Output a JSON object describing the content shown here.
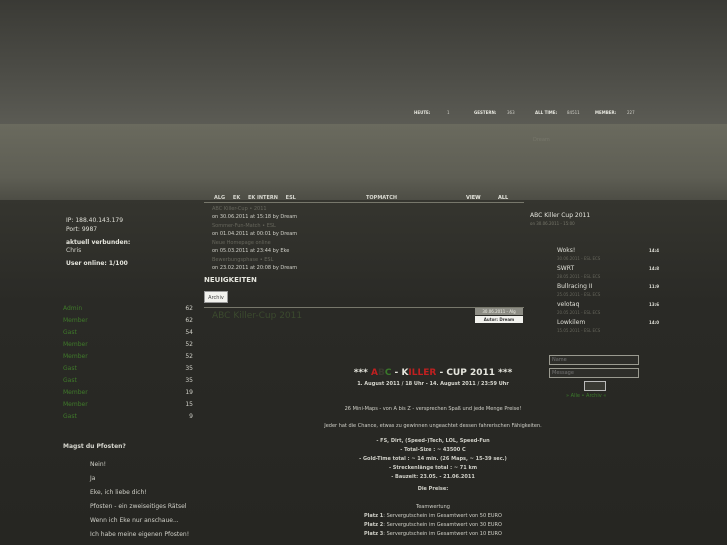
{
  "header": {
    "stats": [
      {
        "label": "HEUTE:",
        "value": "1"
      },
      {
        "label": "GESTERN:",
        "value": "363"
      },
      {
        "label": "ALL TIME:",
        "value": "84511"
      },
      {
        "label": "MEMBER:",
        "value": "227"
      }
    ],
    "faint_text": "Dream"
  },
  "server": {
    "ip": "IP: 188.40.143.179",
    "port": "Port: 9987",
    "connected_heading": "aktuell verbunden:",
    "connected_user": "Chris",
    "online": "User online: 1/100"
  },
  "clan_list": [
    {
      "label": "Admin",
      "count": "62"
    },
    {
      "label": "Member",
      "count": "62"
    },
    {
      "label": "Gast",
      "count": "54"
    },
    {
      "label": "Member",
      "count": "52"
    },
    {
      "label": "Member",
      "count": "52"
    },
    {
      "label": "Gast",
      "count": "35"
    },
    {
      "label": "Gast",
      "count": "35"
    },
    {
      "label": "Member",
      "count": "19"
    },
    {
      "label": "Member",
      "count": "15"
    },
    {
      "label": "Gast",
      "count": "9"
    }
  ],
  "poll": {
    "question": "Magst du Pfosten?",
    "options": [
      "Nein!",
      "Ja",
      "Eke, ich liebe dich!",
      "Pfosten - ein zweiseitiges Rätsel",
      "Wenn ich Eke nur anschaue...",
      "Ich habe meine eigenen Pfosten!"
    ]
  },
  "tabs": {
    "items": [
      "ALG",
      "EK",
      "EK INTERN",
      "ESL"
    ],
    "topmatch": "TOPMATCH",
    "view": "VIEW",
    "all": "ALL"
  },
  "news_items": [
    {
      "title": "ABC Killer-Cup • 2011",
      "meta": "on 30.06.2011 at 15:18 by Dream"
    },
    {
      "title": "Sommer-Fun-Match • ESL",
      "meta": "on 01.04.2011 at 00:01 by Dream"
    },
    {
      "title": "Neue Homepage online",
      "meta": "on 05.03.2011 at 23:44 by Eke"
    },
    {
      "title": "Bewerbungsphase • ESL",
      "meta": "on 23.02.2011 at 20:08 by Dream"
    }
  ],
  "neuigkeiten": {
    "heading": "NEUIGKEITEN",
    "archiv_label": "Archiv",
    "post_date": "30.06.2011 - Alg",
    "post_author": "Autor: Dream",
    "post_title": "ABC Killer-Cup 2011"
  },
  "post": {
    "title_prefix": "*** ",
    "title_a": "A",
    "title_b": "B",
    "title_c": "C",
    "title_dash1": " - ",
    "title_k": "K",
    "title_rest": "ILLER",
    "title_suffix": " - CUP 2011 ***",
    "subtitle": "1. August 2011 / 18 Uhr - 14. August 2011 / 23:59 Uhr",
    "line1": "26 Mini-Maps - von A bis Z - versprechen Spaß und jede Menge Preise!",
    "line2": "Jeder hat die Chance, etwas zu gewinnen ungeachtet dessen fahrerischen Fähigkeiten.",
    "specs": [
      "- FS, Dirt, (Speed-)Tech, LOL, Speed-Fun",
      "- Total-Size : ~ 43500 C",
      "- Gold-Time total : ~ 14 min. (26 Maps, ~ 15-39 sec.)",
      "- Streckenlänge total : ~ 71 km",
      "- Bauzeit: 23.05. - 21.06.2011"
    ],
    "prizes_head": "Die Preise:",
    "team_label": "Teamwertung",
    "prizes": [
      {
        "place": "Platz 1",
        "text": ": Servergutschein im Gesamtwert von 50 EURO"
      },
      {
        "place": "Platz 2",
        "text": ": Servergutschein im Gesamtwert von 30 EURO"
      },
      {
        "place": "Platz 3",
        "text": ": Servergutschein im Gesamtwert von 10 EURO"
      }
    ]
  },
  "right": {
    "abc_head": "ABC Killer Cup 2011",
    "abc_date": "on 30.06.2011 - 15:00",
    "matches": [
      {
        "name": "Woks!",
        "score": "14:4",
        "meta": "30.06.2011 - ESL ECS"
      },
      {
        "name": "SWRT",
        "score": "14:8",
        "meta": "28.05.2011 - ESL ECS"
      },
      {
        "name": "Bullracing II",
        "score": "11:9",
        "meta": "25.05.2011 - ESL ECS"
      },
      {
        "name": "velotaq",
        "score": "13:6",
        "meta": "20.05.2011 - ESL ECS"
      },
      {
        "name": "Lowkilem",
        "score": "14:0",
        "meta": "15.05.2011 - ESL ECS"
      }
    ]
  },
  "shoutbox": {
    "name_placeholder": "Name",
    "message_placeholder": "Message",
    "links": "» Alle • Archiv «"
  }
}
